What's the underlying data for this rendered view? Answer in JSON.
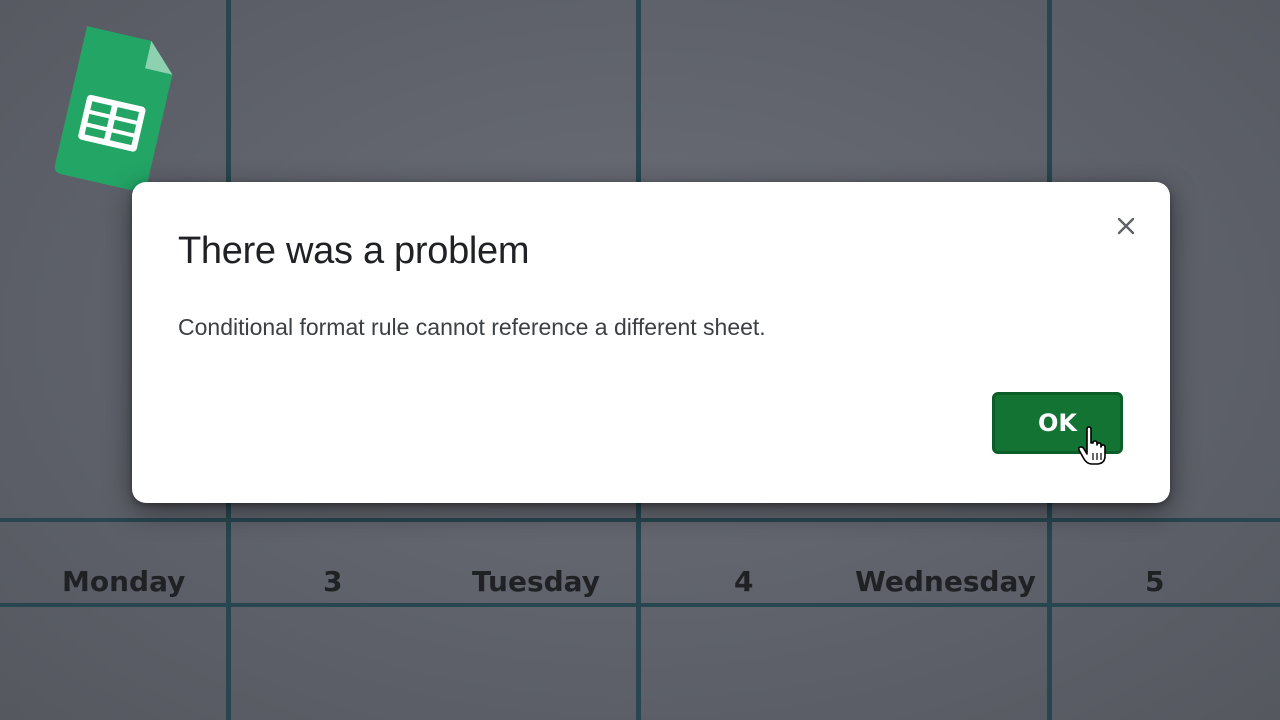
{
  "dialog": {
    "title": "There was a problem",
    "message": "Conditional format rule cannot reference a different sheet.",
    "ok_label": "OK",
    "close_icon": "close-icon"
  },
  "background_cells": {
    "row": [
      {
        "text": "Monday"
      },
      {
        "text": "3"
      },
      {
        "text": "Tuesday"
      },
      {
        "text": "4"
      },
      {
        "text": "Wednesday"
      },
      {
        "text": "5"
      }
    ]
  },
  "icons": {
    "app_logo": "google-sheets-icon",
    "pointer": "hand-pointer-icon"
  },
  "colors": {
    "accent_green": "#137333",
    "background": "#62656e",
    "grid_line": "#27464f"
  }
}
